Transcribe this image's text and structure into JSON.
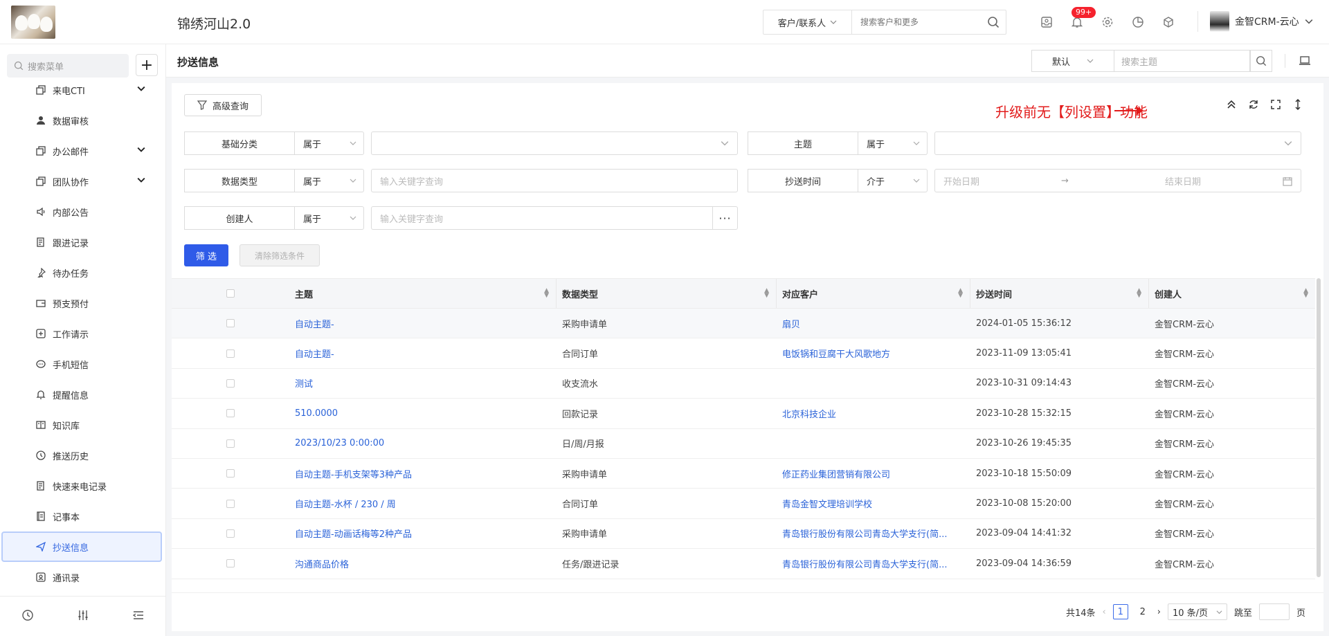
{
  "header": {
    "app_title": "锦绣河山2.0",
    "search_type": "客户/联系人",
    "search_placeholder": "搜索客户和更多",
    "notification_badge": "99+",
    "user_name": "金智CRM-云心"
  },
  "sidebar": {
    "search_placeholder": "搜索菜单",
    "items": [
      {
        "label": "来电CTI",
        "icon": "copy-icon",
        "expandable": true
      },
      {
        "label": "数据审核",
        "icon": "user-check-icon",
        "expandable": false
      },
      {
        "label": "办公邮件",
        "icon": "copy-icon",
        "expandable": true
      },
      {
        "label": "团队协作",
        "icon": "copy-icon",
        "expandable": true
      },
      {
        "label": "内部公告",
        "icon": "speaker-icon",
        "expandable": false
      },
      {
        "label": "跟进记录",
        "icon": "edit-note-icon",
        "expandable": false
      },
      {
        "label": "待办任务",
        "icon": "pin-icon",
        "expandable": false
      },
      {
        "label": "预支预付",
        "icon": "wallet-icon",
        "expandable": false
      },
      {
        "label": "工作请示",
        "icon": "plus-box-icon",
        "expandable": false
      },
      {
        "label": "手机短信",
        "icon": "chat-icon",
        "expandable": false
      },
      {
        "label": "提醒信息",
        "icon": "bell-icon",
        "expandable": false
      },
      {
        "label": "知识库",
        "icon": "book-icon",
        "expandable": false
      },
      {
        "label": "推送历史",
        "icon": "clock-icon",
        "expandable": false
      },
      {
        "label": "快速来电记录",
        "icon": "edit-note-icon",
        "expandable": false
      },
      {
        "label": "记事本",
        "icon": "notebook-icon",
        "expandable": false
      },
      {
        "label": "抄送信息",
        "icon": "send-icon",
        "expandable": false,
        "active": true
      },
      {
        "label": "通讯录",
        "icon": "contacts-icon",
        "expandable": false
      }
    ]
  },
  "page": {
    "title": "抄送信息",
    "view_select": "默认",
    "theme_search_placeholder": "搜索主题"
  },
  "filters": {
    "advanced_label": "高级查询",
    "annotation": "升级前无【列设置】功能",
    "rows": [
      {
        "label": "基础分类",
        "op": "属于",
        "value": ""
      },
      {
        "label": "主题",
        "op": "属于",
        "value": ""
      },
      {
        "label": "数据类型",
        "op": "属于",
        "value": "输入关键字查询"
      },
      {
        "label": "抄送时间",
        "op": "介于",
        "start": "开始日期",
        "end": "结束日期"
      },
      {
        "label": "创建人",
        "op": "属于",
        "value": "输入关键字查询"
      }
    ],
    "filter_btn": "筛 选",
    "clear_btn": "清除筛选条件"
  },
  "table": {
    "columns": [
      "主题",
      "数据类型",
      "对应客户",
      "抄送时间",
      "创建人"
    ],
    "rows": [
      {
        "subject": "自动主题-",
        "type": "采购申请单",
        "customer": "扇贝",
        "time": "2024-01-05 15:36:12",
        "creator": "金智CRM-云心"
      },
      {
        "subject": "自动主题-",
        "type": "合同订单",
        "customer": "电饭锅和豆腐干大风歌地方",
        "time": "2023-11-09 13:05:41",
        "creator": "金智CRM-云心"
      },
      {
        "subject": "测试",
        "type": "收支流水",
        "customer": "",
        "time": "2023-10-31 09:14:43",
        "creator": "金智CRM-云心"
      },
      {
        "subject": "510.0000",
        "type": "回款记录",
        "customer": "北京科技企业",
        "time": "2023-10-28 15:32:15",
        "creator": "金智CRM-云心"
      },
      {
        "subject": "2023/10/23 0:00:00",
        "type": "日/周/月报",
        "customer": "",
        "time": "2023-10-26 19:45:35",
        "creator": "金智CRM-云心"
      },
      {
        "subject": "自动主题-手机支架等3种产品",
        "type": "采购申请单",
        "customer": "修正药业集团营销有限公司",
        "time": "2023-10-18 15:50:09",
        "creator": "金智CRM-云心"
      },
      {
        "subject": "自动主题-水杯 / 230 / 周",
        "type": "合同订单",
        "customer": "青岛金智文理培训学校",
        "time": "2023-10-08 15:20:00",
        "creator": "金智CRM-云心"
      },
      {
        "subject": "自动主题-动画话梅等2种产品",
        "type": "采购申请单",
        "customer": "青岛银行股份有限公司青岛大学支行(简...",
        "time": "2023-09-04 14:41:32",
        "creator": "金智CRM-云心"
      },
      {
        "subject": "沟通商品价格",
        "type": "任务/跟进记录",
        "customer": "青岛银行股份有限公司青岛大学支行(简...",
        "time": "2023-09-04 14:36:59",
        "creator": "金智CRM-云心"
      }
    ]
  },
  "pager": {
    "total": "共14条",
    "pages": [
      "1",
      "2"
    ],
    "page_size": "10 条/页",
    "jump_label": "跳至",
    "page_unit": "页"
  }
}
